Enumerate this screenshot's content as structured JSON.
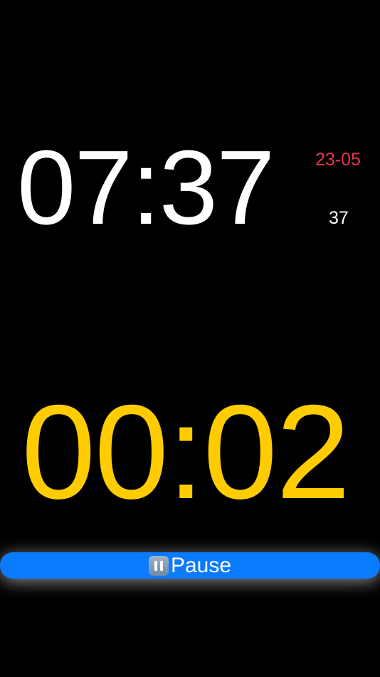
{
  "clock": {
    "time": "07:37",
    "date": "23-05",
    "seconds": "37"
  },
  "timer": {
    "value": "00:02"
  },
  "controls": {
    "pause_label": "Pause",
    "pause_icon": "pause-icon"
  },
  "colors": {
    "background": "#000000",
    "clock_time": "#ffffff",
    "date": "#e5364f",
    "timer": "#ffcc00",
    "button": "#0a7aff"
  }
}
